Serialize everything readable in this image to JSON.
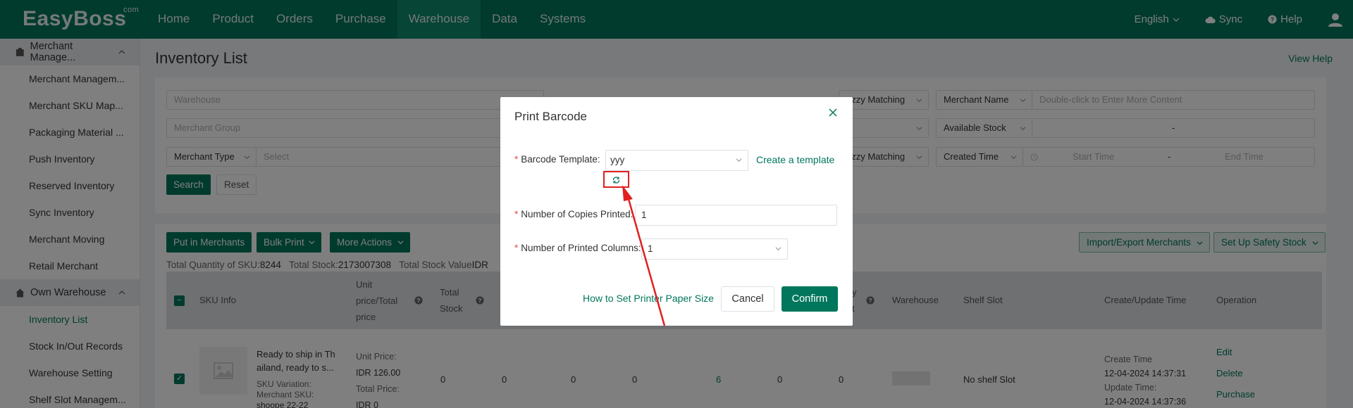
{
  "brand": {
    "name": "EasyBoss",
    "suffix": "com"
  },
  "nav": [
    "Home",
    "Product",
    "Orders",
    "Purchase",
    "Warehouse",
    "Data",
    "Systems"
  ],
  "topright": {
    "language": "English",
    "sync": "Sync",
    "help": "Help"
  },
  "sidebar": {
    "group1": "Merchant Manage...",
    "items1": [
      "Merchant Managem...",
      "Merchant SKU Map...",
      "Packaging Material ...",
      "Push Inventory",
      "Reserved Inventory",
      "Sync Inventory",
      "Merchant Moving",
      "Retail Merchant"
    ],
    "group2": "Own Warehouse",
    "items2": [
      "Inventory List",
      "Stock In/Out Records",
      "Warehouse Setting",
      "Shelf Slot Managem..."
    ]
  },
  "page": {
    "title": "Inventory List",
    "view_help": "View Help"
  },
  "filters": {
    "warehouse_placeholder": "Warehouse",
    "merchant_group_placeholder": "Merchant Group",
    "merchant_type": "Merchant Type",
    "select_placeholder": "Select",
    "fuzzy1": "uzzy Matching",
    "fuzzy2": "uzzy Matching",
    "merchant_name": "Merchant Name",
    "merchant_name_placeholder": "Double-click to Enter More Content",
    "available_stock": "Available Stock",
    "range_sep": "-",
    "created_time": "Created Time",
    "start_time": "Start Time",
    "end_time": "End Time",
    "search": "Search",
    "reset": "Reset"
  },
  "actions": {
    "put_in_merchants": "Put in Merchants",
    "bulk_print": "Bulk Print",
    "more_actions": "More Actions",
    "import_export": "Import/Export Merchants",
    "safety_stock": "Set Up Safety Stock"
  },
  "summary": {
    "qty_label": "Total Quantity of SKU:",
    "qty_value": "8244",
    "stock_label": "Total Stock:",
    "stock_value": "2173007308",
    "value_label": "Total Stock Value",
    "value_value": "IDR"
  },
  "table": {
    "headers": {
      "sku_info": "SKU Info",
      "unit_price_1": "Unit",
      "unit_price_2": "price/Total",
      "unit_price_3": "price",
      "total_stock_1": "Total",
      "total_stock_2": "Stock",
      "y": "y",
      "t": "t",
      "warehouse": "Warehouse",
      "shelf_slot": "Shelf Slot",
      "create_update": "Create/Update Time",
      "operation": "Operation"
    },
    "row": {
      "title_1": "Ready to ship in Th",
      "title_2": "ailand, ready to s...",
      "sku_variation": "SKU Variation:",
      "merchant_sku": "Merchant SKU:",
      "sku_value": "shoope 22-22",
      "unit_price_label": "Unit Price:",
      "unit_price": "IDR 126.00",
      "total_price_label": "Total Price:",
      "total_price": "IDR 0",
      "values": [
        "0",
        "0",
        "0",
        "0",
        "6",
        "0",
        "0"
      ],
      "shelf_slot": "No shelf Slot",
      "create_label": "Create Time",
      "create_time": "12-04-2024 14:37:31",
      "update_label": "Update Time:",
      "update_time": "12-04-2024 14:37:36",
      "op_edit": "Edit",
      "op_delete": "Delete",
      "op_purchase": "Purchase"
    }
  },
  "modal": {
    "title": "Print Barcode",
    "template_label": "Barcode Template:",
    "template_value": "yyy",
    "create_template": "Create a template",
    "copies_label": "Number of Copies Printed:",
    "copies_value": "1",
    "columns_label": "Number of Printed Columns:",
    "columns_value": "1",
    "paper_help": "How to Set Printer Paper Size",
    "cancel": "Cancel",
    "confirm": "Confirm",
    "required_mark": "*"
  },
  "colors": {
    "primary": "#00775c",
    "annotation": "#e02020"
  }
}
